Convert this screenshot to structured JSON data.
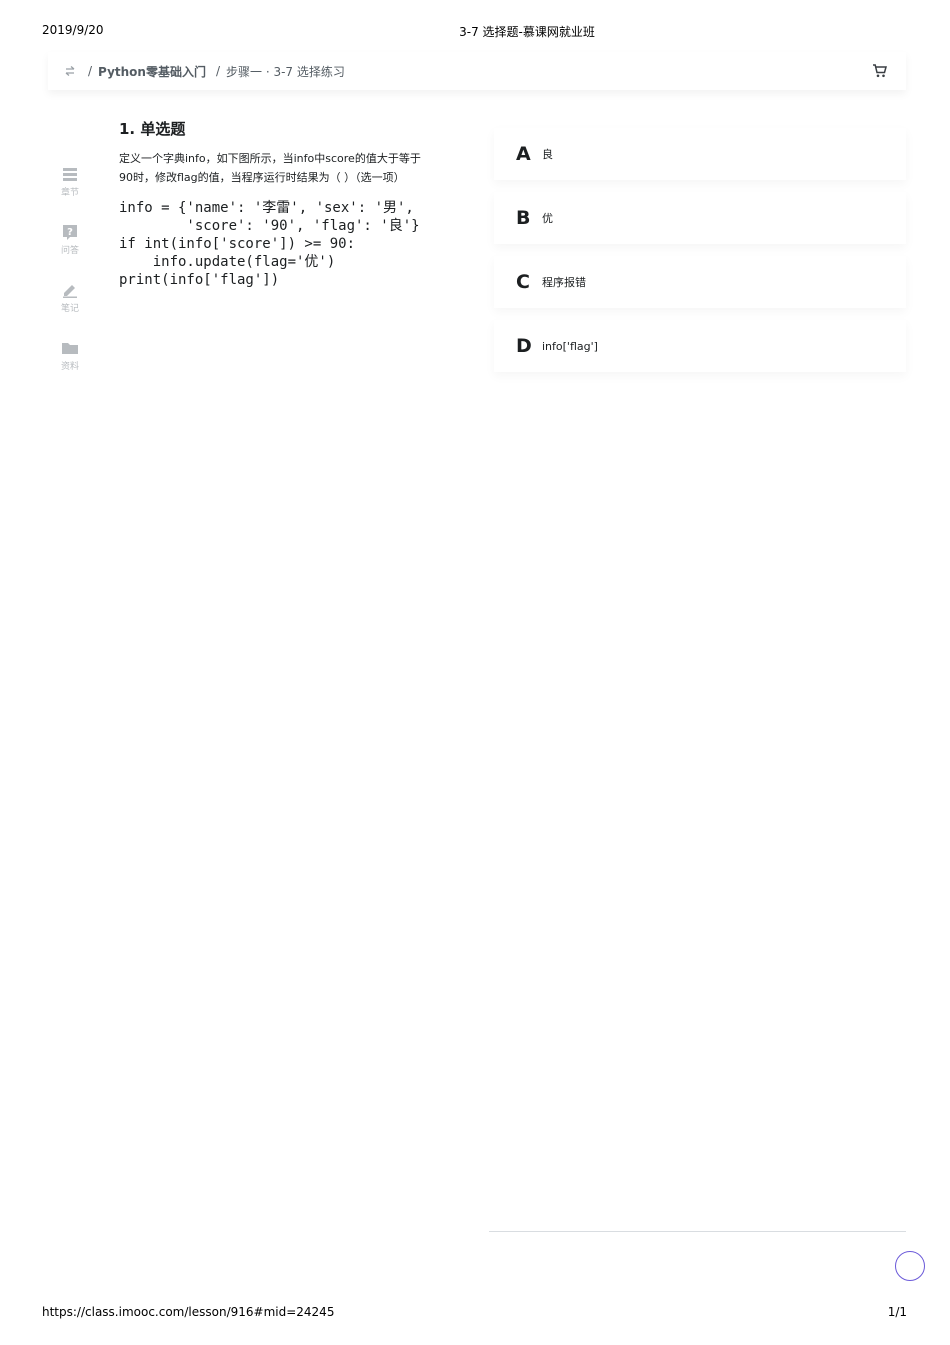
{
  "print_header": {
    "date": "2019/9/20",
    "title": "3-7 选择题-慕课网就业班"
  },
  "print_footer": {
    "url": "https://class.imooc.com/lesson/916#mid=24245",
    "page": "1/1"
  },
  "topbar": {
    "back_icon": "switch-arrows-icon",
    "separator": "/",
    "course": "Python零基础入门",
    "lesson": "步骤一 · 3-7 选择练习",
    "cart_icon": "cart-icon"
  },
  "sidebar": {
    "items": [
      {
        "label": "章节",
        "icon": "chapters-icon"
      },
      {
        "label": "问答",
        "icon": "question-icon"
      },
      {
        "label": "笔记",
        "icon": "pencil-icon"
      },
      {
        "label": "资料",
        "icon": "folder-icon"
      }
    ]
  },
  "question": {
    "title": "1. 单选题",
    "text": "定义一个字典info，如下图所示，当info中score的值大于等于90时，修改flag的值，当程序运行时结果为（ ）（选一项）",
    "code": [
      "info = {'name': '李雷', 'sex': '男',",
      "        'score': '90', 'flag': '良'}",
      "if int(info['score']) >= 90:",
      "    info.update(flag='优')",
      "print(info['flag'])"
    ]
  },
  "options": [
    {
      "letter": "A",
      "text": "良"
    },
    {
      "letter": "B",
      "text": "优"
    },
    {
      "letter": "C",
      "text": "程序报错"
    },
    {
      "letter": "D",
      "text": "info['flag']"
    }
  ],
  "colors": {
    "accent": "#6b5ad9",
    "muted": "#b7bbbf",
    "text": "#1c1f21"
  }
}
